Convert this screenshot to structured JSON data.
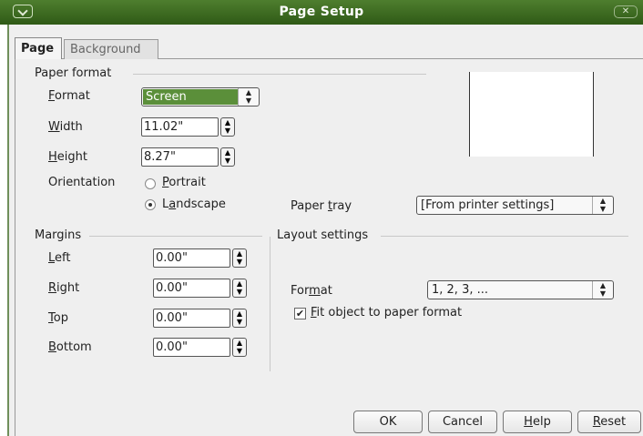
{
  "window": {
    "title": "Page Setup",
    "close_symbol": "✕"
  },
  "tabs": [
    {
      "label": "Page",
      "active": true
    },
    {
      "label": "Background",
      "active": false
    }
  ],
  "paper_format": {
    "section": "Paper format",
    "format_label_pre": "",
    "format_label_u": "F",
    "format_label_post": "ormat",
    "format_value": "Screen",
    "width_label_u": "W",
    "width_label_post": "idth",
    "width_value": "11.02\"",
    "height_label_u": "H",
    "height_label_post": "eight",
    "height_value": "8.27\"",
    "orientation_label": "Orientation",
    "portrait_u": "P",
    "portrait_post": "ortrait",
    "landscape_pre": "L",
    "landscape_u": "a",
    "landscape_post": "ndscape",
    "orientation_selected": "Landscape",
    "paper_tray_pre": "Paper ",
    "paper_tray_u": "t",
    "paper_tray_post": "ray",
    "paper_tray_value": "[From printer settings]"
  },
  "margins": {
    "section": "Margins",
    "left_u": "L",
    "left_post": "eft",
    "left_value": "0.00\"",
    "right_u": "R",
    "right_post": "ight",
    "right_value": "0.00\"",
    "top_u": "T",
    "top_post": "op",
    "top_value": "0.00\"",
    "bottom_u": "B",
    "bottom_post": "ottom",
    "bottom_value": "0.00\""
  },
  "layout": {
    "section": "Layout settings",
    "format_pre": "For",
    "format_u": "m",
    "format_post": "at",
    "format_value": "1, 2, 3, ...",
    "fit_u": "F",
    "fit_post": "it object to paper format",
    "fit_checked": true
  },
  "buttons": {
    "ok": "OK",
    "cancel": "Cancel",
    "help_u": "H",
    "help_post": "elp",
    "reset_u": "R",
    "reset_post": "eset"
  },
  "colors": {
    "titlebar": "#3f6d22",
    "format_highlight": "#5b8f3a"
  }
}
